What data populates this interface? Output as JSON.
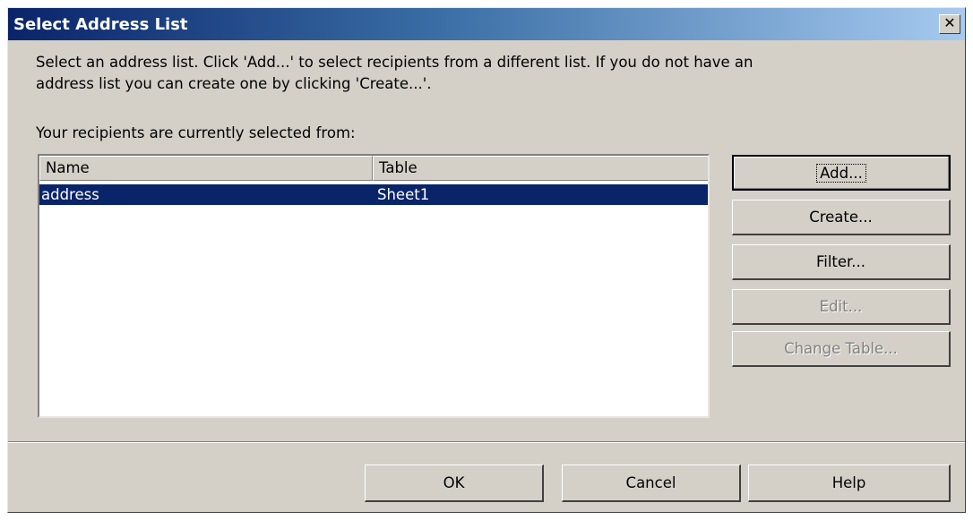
{
  "dialog": {
    "title": "Select Address List",
    "close_glyph": "✕",
    "description_line1": "Select an address list. Click 'Add...' to select recipients from a different list. If you do not have an",
    "description_line2": "address list you can create one by clicking 'Create...'.",
    "current_label": "Your recipients are currently selected from:"
  },
  "list": {
    "columns": [
      "Name",
      "Table"
    ],
    "rows": [
      {
        "name": "address",
        "table": "Sheet1",
        "selected": true
      }
    ]
  },
  "buttons": {
    "add": "Add...",
    "create": "Create...",
    "filter": "Filter...",
    "edit": "Edit...",
    "change_table": "Change Table...",
    "ok": "OK",
    "cancel": "Cancel",
    "help": "Help"
  },
  "colors": {
    "title_bar_start": "#0a246a",
    "title_bar_end": "#a6caf0",
    "selection": "#0a246a",
    "dialog_face": "#d4d0c8",
    "disabled_text": "#808080"
  }
}
